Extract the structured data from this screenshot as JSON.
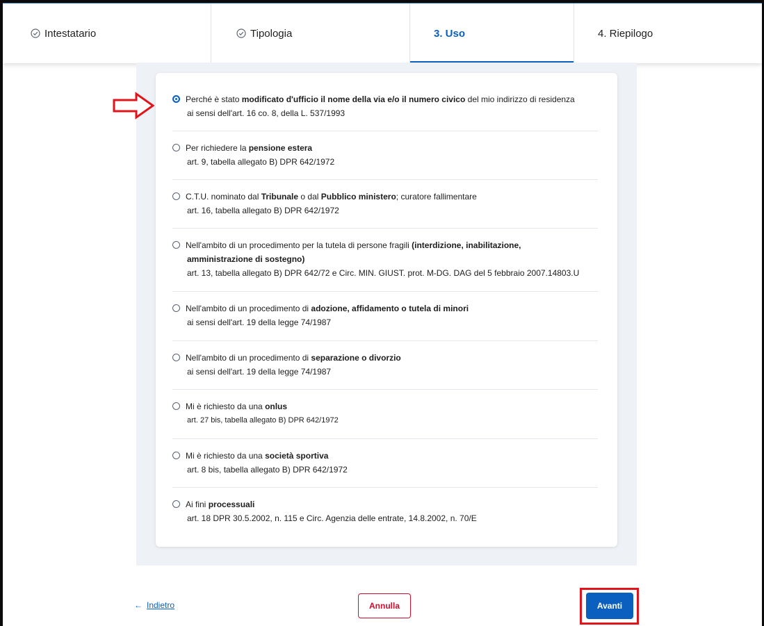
{
  "steps": [
    {
      "label": "Intestatario",
      "done": true,
      "active": false
    },
    {
      "label": "Tipologia",
      "done": true,
      "active": false
    },
    {
      "label": "3. Uso",
      "done": false,
      "active": true
    },
    {
      "label": "4. Riepilogo",
      "done": false,
      "active": false
    }
  ],
  "options": [
    {
      "checked": true,
      "line1": [
        [
          "Perché è stato ",
          false
        ],
        [
          "modificato d'ufficio il nome della via e/o il numero civico",
          true
        ],
        [
          " del mio indirizzo di residenza",
          false
        ]
      ],
      "sub": [
        "ai sensi dell'art. 16 co. 8, della L. 537/1993"
      ]
    },
    {
      "checked": false,
      "line1": [
        [
          "Per richiedere la ",
          false
        ],
        [
          "pensione estera",
          true
        ]
      ],
      "sub": [
        "art. 9, tabella allegato B) DPR 642/1972"
      ]
    },
    {
      "checked": false,
      "line1": [
        [
          "C.T.U. nominato dal ",
          false
        ],
        [
          "Tribunale",
          true
        ],
        [
          " o dal ",
          false
        ],
        [
          "Pubblico ministero",
          true
        ],
        [
          "; curatore fallimentare",
          false
        ]
      ],
      "sub": [
        "art. 16, tabella allegato B) DPR 642/1972"
      ]
    },
    {
      "checked": false,
      "line1": [
        [
          "Nell'ambito di un procedimento per la tutela di persone fragili ",
          false
        ],
        [
          "(interdizione, inabilitazione,",
          true
        ]
      ],
      "bold_sub": "amministrazione di sostegno)",
      "sub": [
        "art. 13, tabella allegato B) DPR 642/72 e Circ. MIN. GIUST. prot. M-DG. DAG del 5 febbraio 2007.14803.U"
      ]
    },
    {
      "checked": false,
      "line1": [
        [
          "Nell'ambito di un procedimento di ",
          false
        ],
        [
          "adozione, affidamento o tutela di minori",
          true
        ]
      ],
      "sub": [
        "ai sensi dell'art. 19 della legge 74/1987"
      ]
    },
    {
      "checked": false,
      "line1": [
        [
          "Nell'ambito di un procedimento di ",
          false
        ],
        [
          "separazione o divorzio",
          true
        ]
      ],
      "sub": [
        "ai sensi dell'art. 19 della legge 74/1987"
      ]
    },
    {
      "checked": false,
      "line1": [
        [
          "Mi è richiesto da una ",
          false
        ],
        [
          "onlus",
          true
        ]
      ],
      "sub": [
        "art. 27 bis, tabella allegato B) DPR 642/1972"
      ]
    },
    {
      "checked": false,
      "line1": [
        [
          "Mi è richiesto da una ",
          false
        ],
        [
          "società sportiva",
          true
        ]
      ],
      "sub": [
        "art. 8 bis, tabella allegato B) DPR 642/1972"
      ]
    },
    {
      "checked": false,
      "line1": [
        [
          "Ai fini ",
          false
        ],
        [
          "processuali",
          true
        ]
      ],
      "sub": [
        "art. 18 DPR 30.5.2002, n. 115 e Circ. Agenzia delle entrate, 14.8.2002, n. 70/E"
      ]
    }
  ],
  "footer": {
    "back_arrow": "←",
    "back_label": "Indietro",
    "cancel_label": "Annulla",
    "next_label": "Avanti"
  },
  "colors": {
    "primary": "#0a5fbf",
    "danger": "#c8102e",
    "highlight": "#e0141b"
  },
  "icons": {
    "step_done": "check-circle-icon",
    "annotation": "red-arrow-icon"
  }
}
